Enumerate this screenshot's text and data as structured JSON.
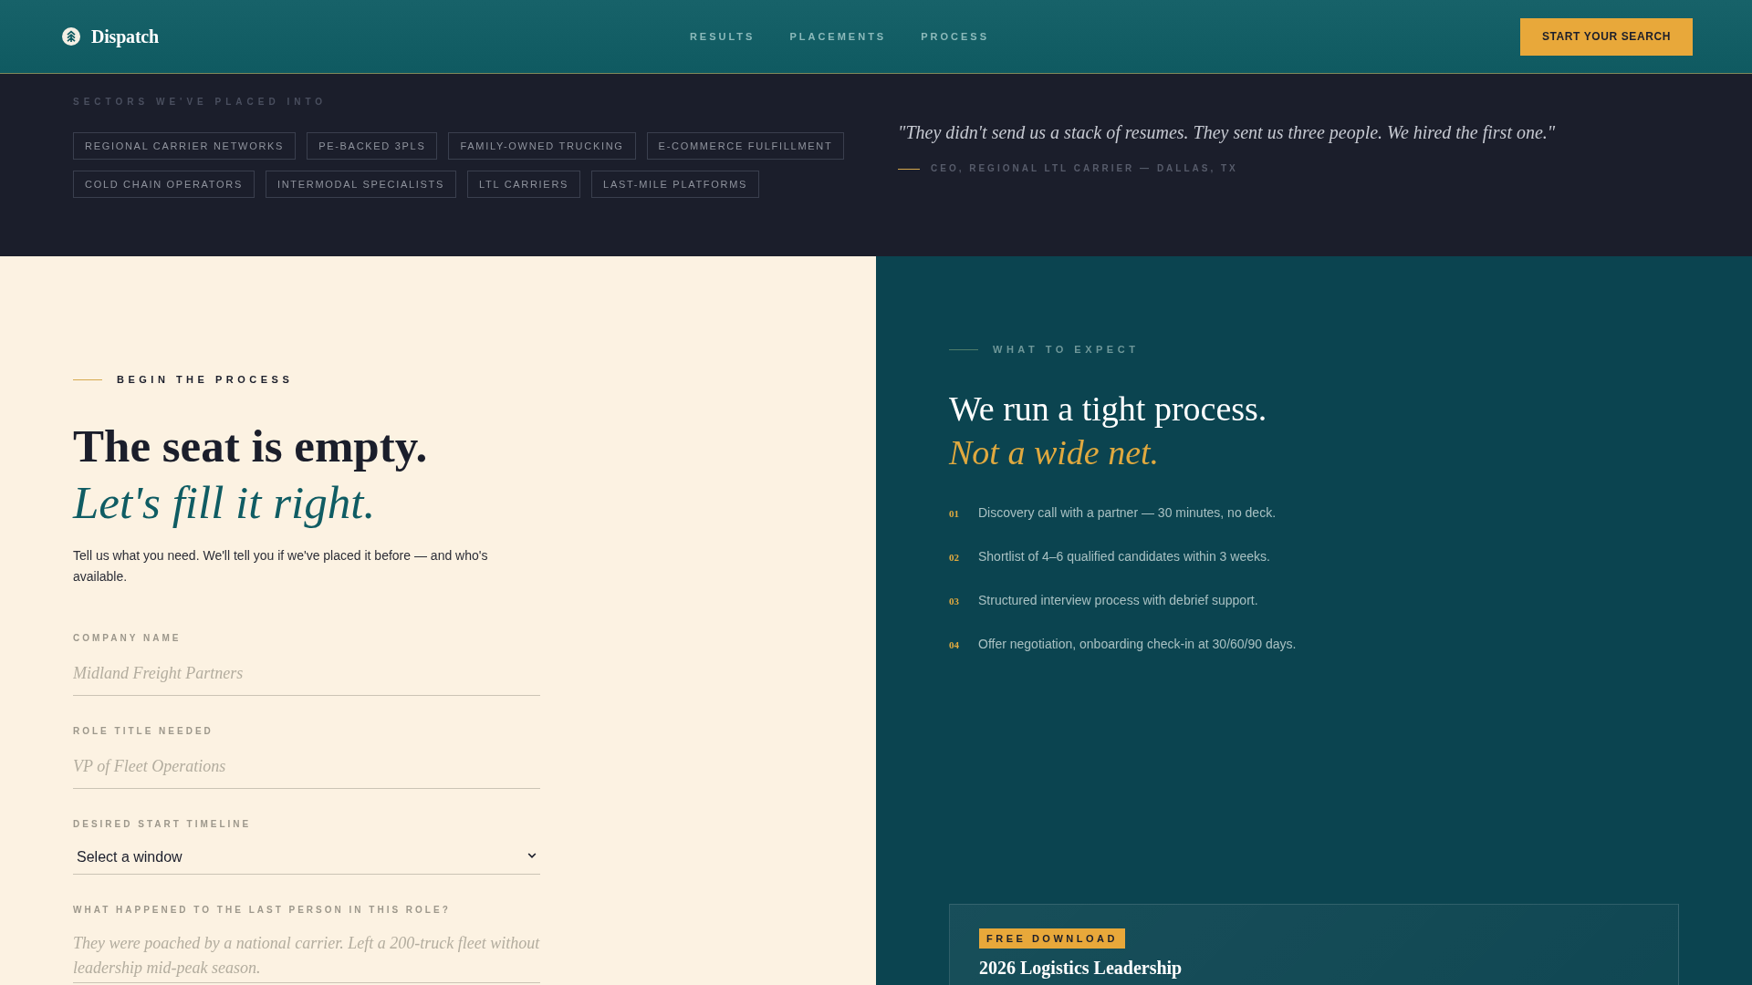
{
  "header": {
    "brand": "Dispatch",
    "nav": [
      "RESULTS",
      "PLACEMENTS",
      "PROCESS"
    ],
    "cta": "START YOUR SEARCH"
  },
  "sectors": {
    "eyebrow": "SECTORS WE'VE PLACED INTO",
    "tags": [
      "REGIONAL CARRIER NETWORKS",
      "PE-BACKED 3PLS",
      "FAMILY-OWNED TRUCKING",
      "E-COMMERCE FULFILLMENT",
      "COLD CHAIN OPERATORS",
      "INTERMODAL SPECIALISTS",
      "LTL CARRIERS",
      "LAST-MILE PLATFORMS"
    ]
  },
  "testimonial": {
    "quote": "\"They didn't send us a stack of resumes. They sent us three people. We hired the first one.\"",
    "attribution": "CEO, REGIONAL LTL CARRIER — DALLAS, TX"
  },
  "form_panel": {
    "eyebrow": "BEGIN THE PROCESS",
    "heading": "The seat is empty.",
    "heading_accent": "Let's fill it right.",
    "intro": "Tell us what you need. We'll tell you if we've placed it before — and who's available.",
    "fields": [
      {
        "kind": "text",
        "label": "COMPANY NAME",
        "placeholder": "Midland Freight Partners"
      },
      {
        "kind": "text",
        "label": "ROLE TITLE NEEDED",
        "placeholder": "VP of Fleet Operations"
      },
      {
        "kind": "select",
        "label": "DESIRED START TIMELINE",
        "value": "Select a window"
      },
      {
        "kind": "textarea",
        "label": "WHAT HAPPENED TO THE LAST PERSON IN THIS ROLE?",
        "placeholder": "They were poached by a national carrier. Left a 200-truck fleet without leadership mid-peak season."
      }
    ]
  },
  "expect_panel": {
    "eyebrow": "WHAT TO EXPECT",
    "heading": "We run a tight process.",
    "heading_accent": "Not a wide net.",
    "steps": [
      {
        "number": "01",
        "text": "Discovery call with a partner — 30 minutes, no deck."
      },
      {
        "number": "02",
        "text": "Shortlist of 4–6 qualified candidates within 3 weeks."
      },
      {
        "number": "03",
        "text": "Structured interview process with debrief support."
      },
      {
        "number": "04",
        "text": "Offer negotiation, onboarding check-in at 30/60/90 days."
      }
    ],
    "download_card": {
      "badge": "FREE DOWNLOAD",
      "title": "2026 Logistics Leadership"
    }
  }
}
